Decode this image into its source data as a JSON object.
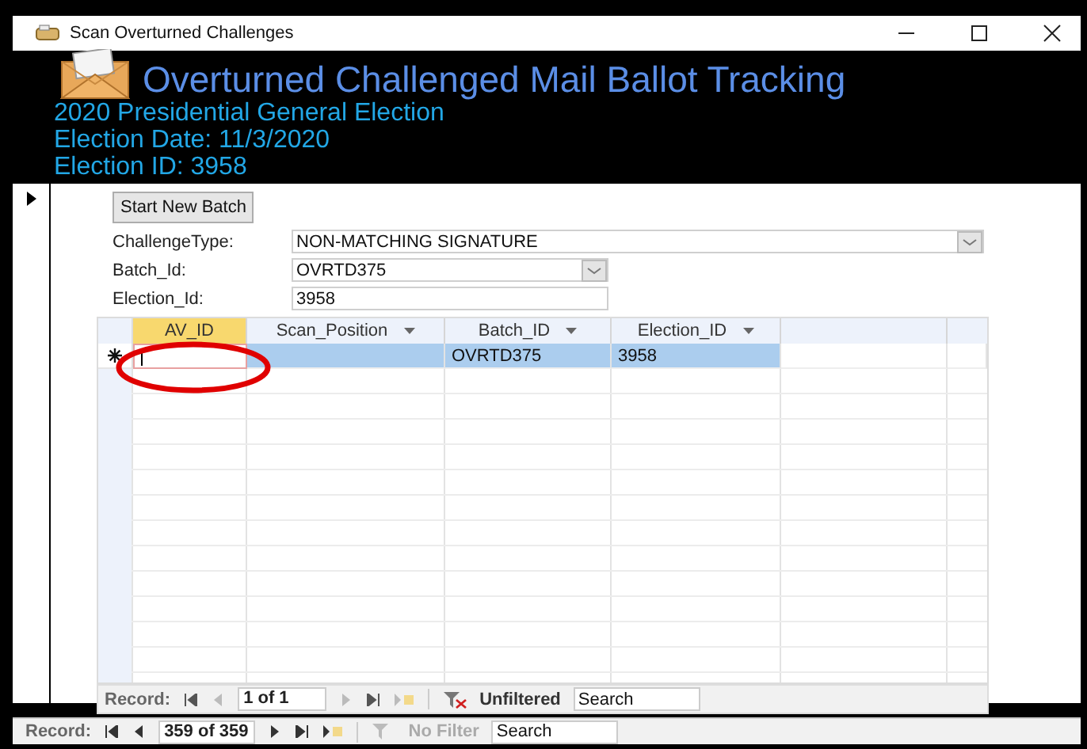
{
  "window": {
    "title": "Scan Overturned Challenges"
  },
  "header": {
    "title": "Overturned Challenged Mail Ballot Tracking",
    "lines": [
      "2020 Presidential General Election",
      "Election Date: 11/3/2020",
      "Election ID: 3958"
    ]
  },
  "form": {
    "button": "Start New Batch",
    "fields": [
      {
        "label": "ChallengeType:",
        "value": "NON-MATCHING SIGNATURE",
        "kind": "combo"
      },
      {
        "label": "Batch_Id:",
        "value": "OVRTD375",
        "kind": "combo"
      },
      {
        "label": "Election_Id:",
        "value": "3958",
        "kind": "text"
      }
    ]
  },
  "datasheet": {
    "columns": [
      {
        "label": "AV_ID",
        "selected": true,
        "filter_arrow": false
      },
      {
        "label": "Scan_Position",
        "selected": false,
        "filter_arrow": true
      },
      {
        "label": "Batch_ID",
        "selected": false,
        "filter_arrow": true
      },
      {
        "label": "Election_ID",
        "selected": false,
        "filter_arrow": true
      }
    ],
    "new_row": {
      "selected": true,
      "cells": [
        null,
        null,
        "OVRTD375",
        "3958"
      ]
    },
    "annotation": {
      "kind": "ellipse",
      "color": "#e00000"
    }
  },
  "subform_nav": {
    "label": "Record:",
    "position": "1 of 1",
    "filter": "Unfiltered",
    "filter_active": true,
    "search": {
      "placeholder": "Search"
    }
  },
  "main_nav": {
    "label": "Record:",
    "position": "359 of 359",
    "filter": "No Filter",
    "filter_active": false,
    "search": {
      "placeholder": "Search"
    }
  }
}
